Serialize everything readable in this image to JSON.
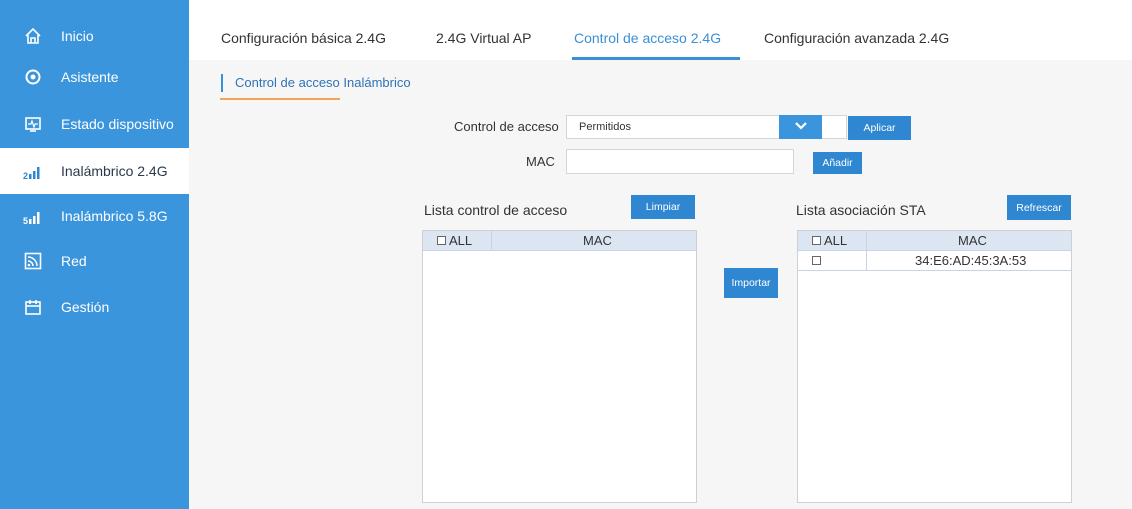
{
  "sidebar": {
    "items": [
      {
        "label": "Inicio",
        "icon": "home-icon"
      },
      {
        "label": "Asistente",
        "icon": "wizard-gear-icon"
      },
      {
        "label": "Estado dispositivo",
        "icon": "device-status-icon"
      },
      {
        "label": "Inalámbrico 2.4G",
        "icon": "wifi-2g-icon",
        "active": true
      },
      {
        "label": "Inalámbrico 5.8G",
        "icon": "wifi-5g-icon"
      },
      {
        "label": "Red",
        "icon": "network-icon"
      },
      {
        "label": "Gestión",
        "icon": "management-icon"
      }
    ]
  },
  "tabs": [
    {
      "label": "Configuración básica 2.4G"
    },
    {
      "label": "2.4G Virtual AP"
    },
    {
      "label": "Control de acceso 2.4G",
      "active": true
    },
    {
      "label": "Configuración avanzada 2.4G"
    }
  ],
  "section_title": "Control de acceso Inalámbrico",
  "form": {
    "access_control_label": "Control de acceso",
    "access_control_value": "Permitidos",
    "apply_button": "Aplicar",
    "mac_label": "MAC",
    "mac_value": "",
    "add_button": "Añadir"
  },
  "acl_list": {
    "title": "Lista control de acceso",
    "clear_button": "Limpiar",
    "columns": [
      "ALL",
      "MAC"
    ],
    "rows": []
  },
  "import_button": "Importar",
  "sta_list": {
    "title": "Lista asociación STA",
    "refresh_button": "Refrescar",
    "columns": [
      "ALL",
      "MAC"
    ],
    "rows": [
      {
        "mac": "34:E6:AD:45:3A:53"
      }
    ]
  },
  "colors": {
    "sidebar": "#3b95dc",
    "accent": "#3a8fd6",
    "button": "#2e87d0",
    "section_underline": "#f0a45a"
  }
}
